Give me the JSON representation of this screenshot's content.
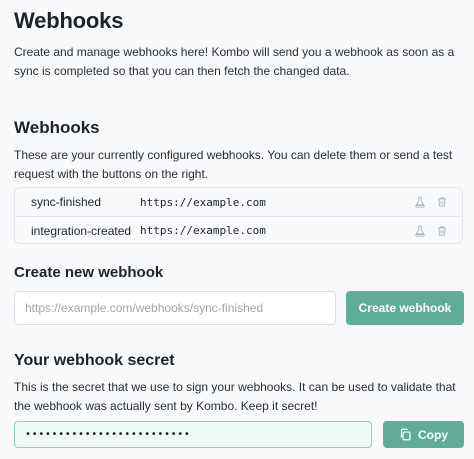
{
  "page": {
    "title": "Webhooks",
    "intro": "Create and manage webhooks here! Kombo will send you a webhook as soon as a sync is completed so that you can then fetch the changed data."
  },
  "webhooks": {
    "heading": "Webhooks",
    "description": "These are your currently configured webhooks. You can delete them or send a test request with the buttons on the right.",
    "rows": [
      {
        "name": "sync-finished",
        "url": "https://example.com"
      },
      {
        "name": "integration-created",
        "url": "https://example.com"
      }
    ]
  },
  "create": {
    "heading": "Create new webhook",
    "placeholder": "https://example.com/webhooks/sync-finished",
    "button_label": "Create webhook"
  },
  "secret": {
    "heading": "Your webhook secret",
    "description": "This is the secret that we use to sign your webhooks. It can be used to validate that the webhook was actually sent by Kombo. Keep it secret!",
    "masked_value": "•••••••••••••••••••••••••",
    "copy_label": "Copy"
  },
  "colors": {
    "accent": "#5fad99",
    "secret_border": "#8fd0b8",
    "secret_bg": "#eef9f4",
    "muted_icon": "#b5b9be"
  },
  "icons": {
    "test": "flask-icon",
    "delete": "trash-icon",
    "copy": "copy-icon"
  }
}
